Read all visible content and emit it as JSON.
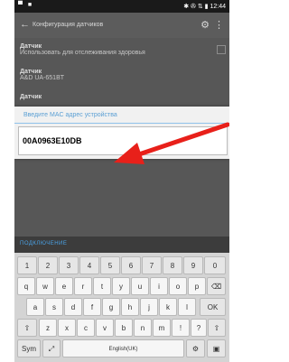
{
  "statusbar": {
    "left": "▀ ■",
    "right": "✱ ✇ ⇅ ▮ 12:44"
  },
  "appbar": {
    "title": "Конфигурация датчиков"
  },
  "prefs": [
    {
      "title": "Датчик",
      "subtitle": "Использовать для отслеживания здоровья"
    },
    {
      "title": "Датчик",
      "subtitle": "A&D UA-651BT"
    },
    {
      "title": "Датчик",
      "subtitle": ""
    }
  ],
  "dialog": {
    "hint": "Введите MAC адрес устройства",
    "value": "00A0963E10DB"
  },
  "keyboard": {
    "layout_label": "ПОДКЛЮЧЕНИЕ",
    "row1": [
      "1",
      "2",
      "3",
      "4",
      "5",
      "6",
      "7",
      "8",
      "9",
      "0"
    ],
    "row2": [
      "q",
      "w",
      "e",
      "r",
      "t",
      "y",
      "u",
      "i",
      "o",
      "p"
    ],
    "row3": [
      "a",
      "s",
      "d",
      "f",
      "g",
      "h",
      "j",
      "k",
      "l"
    ],
    "row4": [
      "z",
      "x",
      "c",
      "v",
      "b",
      "n",
      "m"
    ],
    "ok_label": "OK",
    "sym_label": "Sym",
    "space_label": "English(UK)"
  },
  "colors": {
    "arrow": "#e8201a",
    "accent": "#5a9fd4"
  }
}
